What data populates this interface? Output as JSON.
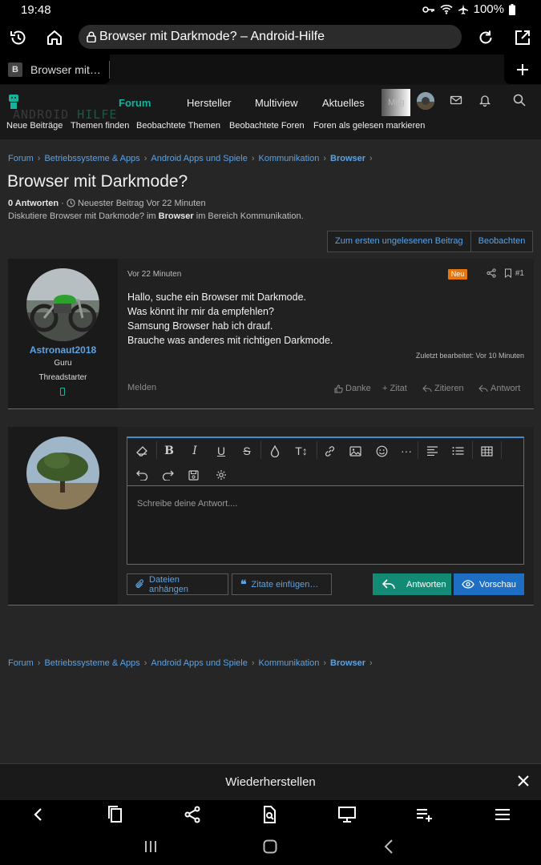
{
  "status": {
    "time": "19:48",
    "battery": "100%"
  },
  "browser": {
    "url_text": "Browser mit Darkmode? – Android-Hilfe",
    "tab_title": "Browser mit…",
    "tab_favicon": "B"
  },
  "site": {
    "logo_left": "ANDROID",
    "logo_right": "HILFE",
    "nav": [
      "Forum",
      "Hersteller",
      "Multiview",
      "Aktuelles"
    ],
    "nav_more": "Mitg",
    "subnav": [
      "Neue Beiträge",
      "Themen finden",
      "Beobachtete Themen",
      "Beobachtete Foren",
      "Foren als gelesen markieren"
    ]
  },
  "breadcrumb": [
    "Forum",
    "Betriebssysteme & Apps",
    "Android Apps und Spiele",
    "Kommunikation",
    "Browser"
  ],
  "thread": {
    "title": "Browser mit Darkmode?",
    "replies": "0 Antworten",
    "latest": "Neuester Beitrag Vor 22 Minuten",
    "desc_prefix": "Diskutiere Browser mit Darkmode? im ",
    "desc_bold": "Browser",
    "desc_suffix": " im Bereich Kommunikation.",
    "btn_unread": "Zum ersten ungelesenen Beitrag",
    "btn_watch": "Beobachten"
  },
  "post": {
    "time": "Vor 22 Minuten",
    "badge": "Neu",
    "number": "#1",
    "lines": [
      "Hallo, suche ein Browser mit Darkmode.",
      "Was könnt ihr mir da empfehlen?",
      "Samsung Browser hab ich drauf.",
      "Brauche was anderes mit richtigen Darkmode."
    ],
    "edited": "Zuletzt bearbeitet: Vor 10 Minuten",
    "report": "Melden",
    "actions": {
      "thanks": "Danke",
      "quote": "Zitat",
      "cite": "Zitieren",
      "reply": "Antwort"
    },
    "user": {
      "name": "Astronaut2018",
      "title": "Guru",
      "badge": "Threadstarter"
    }
  },
  "reply": {
    "placeholder": "Schreibe deine Antwort....",
    "attach": "Dateien anhängen",
    "insert_quotes": "Zitate einfügen…",
    "submit": "Antworten",
    "preview": "Vorschau"
  },
  "restore_bar": {
    "label": "Wiederherstellen"
  },
  "colors": {
    "accent_link": "#5aa3e6",
    "brand_green": "#16b29a",
    "badge_orange": "#e8760f",
    "submit_green": "#138a74",
    "preview_blue": "#1e6fc4"
  }
}
